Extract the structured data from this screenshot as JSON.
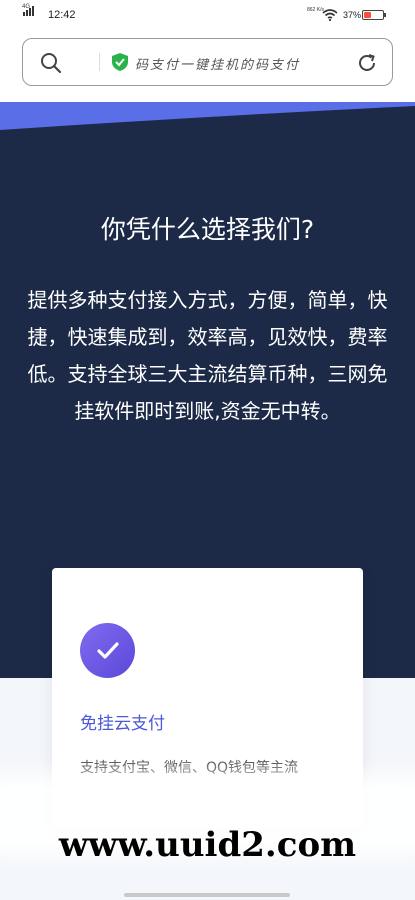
{
  "status_bar": {
    "network": "4G",
    "time": "12:42",
    "net_speed": "862 K/s",
    "battery_percent": "37%",
    "battery_level": 0.37,
    "battery_color": "#ff4d3a"
  },
  "address_bar": {
    "url_text": "码支付一键挂机的码支付",
    "secure_color": "#29b34a"
  },
  "hero": {
    "title": "你凭什么选择我们?",
    "description": "提供多种支付接入方式，方便，简单，快捷，快速集成到，效率高，见效快，费率低。支持全球三大主流结算币种，三网免挂软件即时到账,资金无中转。",
    "background": "#1c2a47",
    "wave_color": "#5a6ee8"
  },
  "feature_card": {
    "icon": "check-icon",
    "title": "免挂云支付",
    "description": "支持支付宝、微信、QQ钱包等主流"
  },
  "watermark": {
    "text": "www.uuid2.com"
  }
}
